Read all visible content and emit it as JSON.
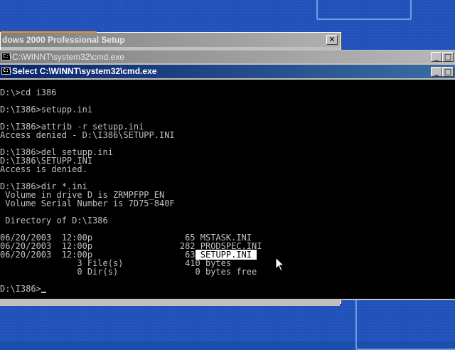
{
  "setup_window": {
    "title": "dows 2000 Professional Setup",
    "close_glyph": "✕"
  },
  "cmd_window_inactive": {
    "title": "C:\\WINNT\\system32\\cmd.exe",
    "icon_text": "C:\\",
    "min_glyph": "_",
    "max_glyph": "□"
  },
  "cmd_window_active": {
    "title": "Select C:\\WINNT\\system32\\cmd.exe",
    "icon_text": "C:\\",
    "min_glyph": "_",
    "max_glyph": "□"
  },
  "console": {
    "lines": [
      "D:\\>cd i386",
      "",
      "D:\\I386>setupp.ini",
      "",
      "D:\\I386>attrib -r setupp.ini",
      "Access denied - D:\\I386\\SETUPP.INI",
      "",
      "D:\\I386>del setupp.ini",
      "D:\\I386\\SETUPP.INI",
      "Access is denied.",
      "",
      "D:\\I386>dir *.ini",
      " Volume in drive D is ZRMPFPP_EN",
      " Volume Serial Number is 7D75-840F",
      "",
      " Directory of D:\\I386",
      "",
      "06/20/2003  12:00p                  65 MSTASK.INI",
      "06/20/2003  12:00p                 282 PRODSPEC.INI",
      "06/20/2003  12:00p                  63",
      "               3 File(s)            410 bytes",
      "               0 Dir(s)               0 bytes free",
      "",
      "D:\\I386>"
    ],
    "selected_text": " SETUPP.INI "
  }
}
